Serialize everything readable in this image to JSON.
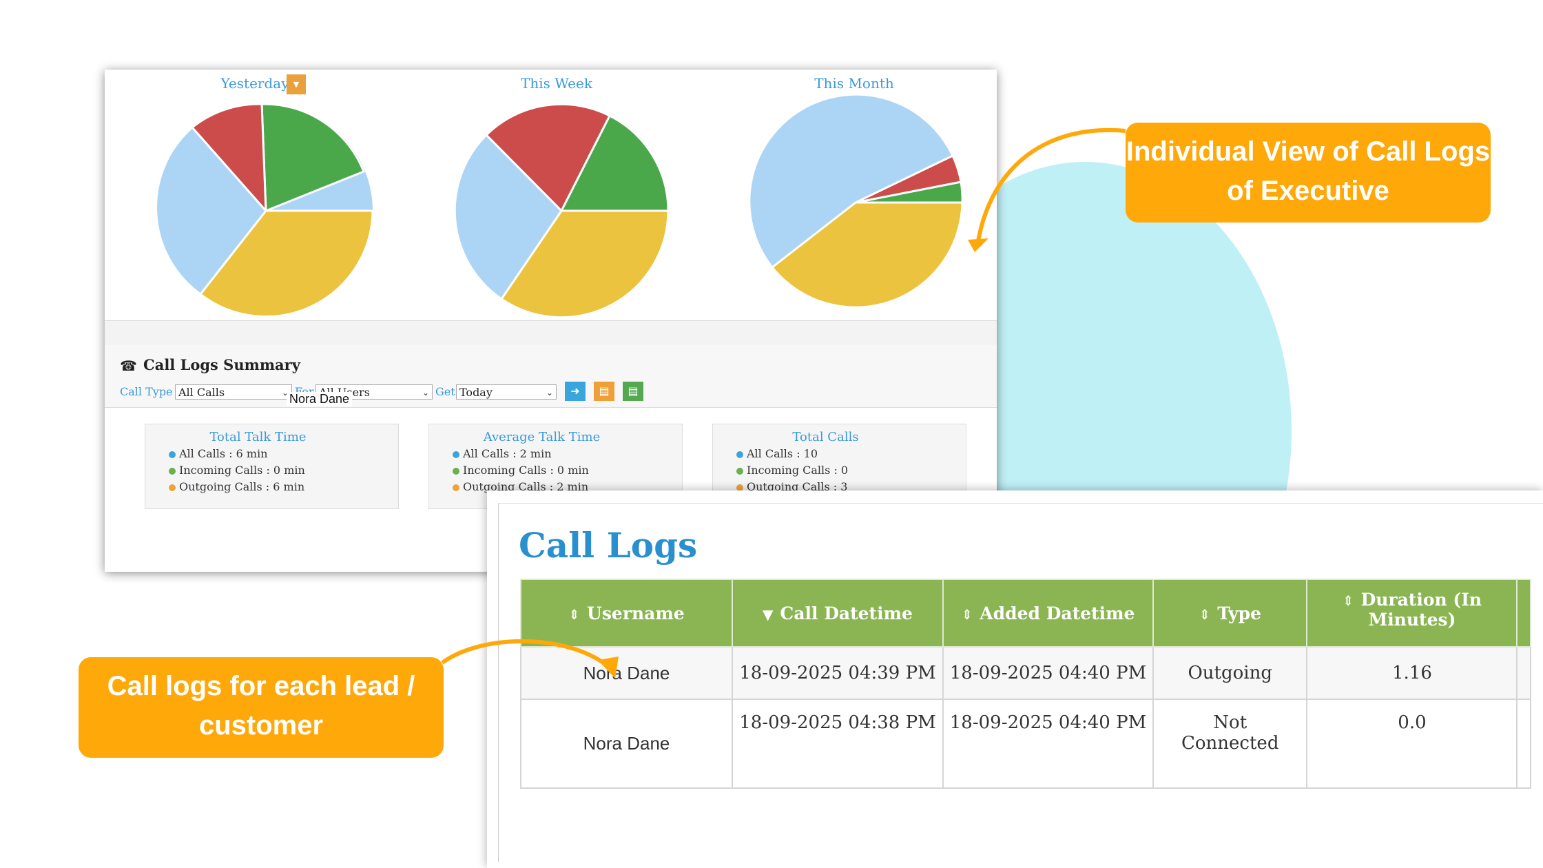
{
  "charts": {
    "yesterday": {
      "title": "Yesterday"
    },
    "this_week": {
      "title": "This Week"
    },
    "this_month": {
      "title": "This Month"
    }
  },
  "pie_colors": {
    "red": "#cc4b4b",
    "green": "#4aa84b",
    "yellow": "#ecc33f",
    "blue": "#acd5f5"
  },
  "summary": {
    "title": "Call Logs Summary",
    "filters": {
      "call_type_label": "Call Type",
      "call_type_value": "All Calls",
      "for_label": "For",
      "for_value": "All Users",
      "get_label": "Get",
      "get_value": "Today"
    },
    "tooltip": "Nora Dane",
    "cards": [
      {
        "title": "Total Talk Time",
        "rows": [
          "All Calls : 6 min",
          "Incoming Calls : 0 min",
          "Outgoing Calls : 6 min"
        ]
      },
      {
        "title": "Average Talk Time",
        "rows": [
          "All Calls : 2 min",
          "Incoming Calls : 0 min",
          "Outgoing Calls : 2 min"
        ]
      },
      {
        "title": "Total Calls",
        "rows": [
          "All Calls : 10",
          "Incoming Calls : 0",
          "Outgoing Calls : 3"
        ]
      }
    ]
  },
  "call_logs": {
    "title": "Call Logs",
    "headers": [
      "Username",
      "Call Datetime",
      "Added Datetime",
      "Type",
      "Duration (In Minutes)"
    ],
    "rows": [
      {
        "username": "Nora Dane",
        "call_datetime": "18-09-2025 04:39 PM",
        "added_datetime": "18-09-2025 04:40 PM",
        "type": "Outgoing",
        "duration": "1.16"
      },
      {
        "username": "Nora Dane",
        "call_datetime": "18-09-2025 04:38 PM",
        "added_datetime": "18-09-2025 04:40 PM",
        "type": "Not Connected",
        "duration": "0.0"
      }
    ]
  },
  "callouts": {
    "executive": "Individual View of Call Logs of Executive",
    "lead": "Call logs for each lead / customer"
  },
  "accent_colors": {
    "callout": "#ffa80a",
    "header_green": "#8ab552",
    "link_blue": "#3a9ad9"
  }
}
